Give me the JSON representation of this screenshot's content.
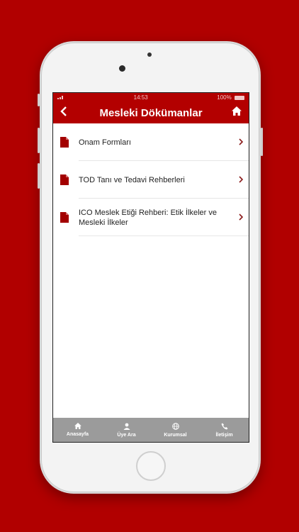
{
  "status_bar": {
    "carrier": "",
    "time": "14:53",
    "battery": "100%"
  },
  "nav_bar": {
    "title": "Mesleki Dökümanlar"
  },
  "documents": [
    {
      "label": "Onam Formları"
    },
    {
      "label": "TOD Tanı ve Tedavi Rehberleri"
    },
    {
      "label": "ICO Meslek Etiği Rehberi: Etik İlkeler ve Mesleki İlkeler"
    }
  ],
  "tab_bar": {
    "items": [
      {
        "label": "Anasayfa",
        "icon": "home-icon"
      },
      {
        "label": "Üye Ara",
        "icon": "user-search-icon"
      },
      {
        "label": "Kurumsal",
        "icon": "globe-icon"
      },
      {
        "label": "İletişim",
        "icon": "phone-icon"
      }
    ]
  },
  "colors": {
    "background": "#b10000",
    "nav": "#b30000",
    "tab_bar": "#9b9b9b",
    "doc_icon": "#a30000"
  }
}
